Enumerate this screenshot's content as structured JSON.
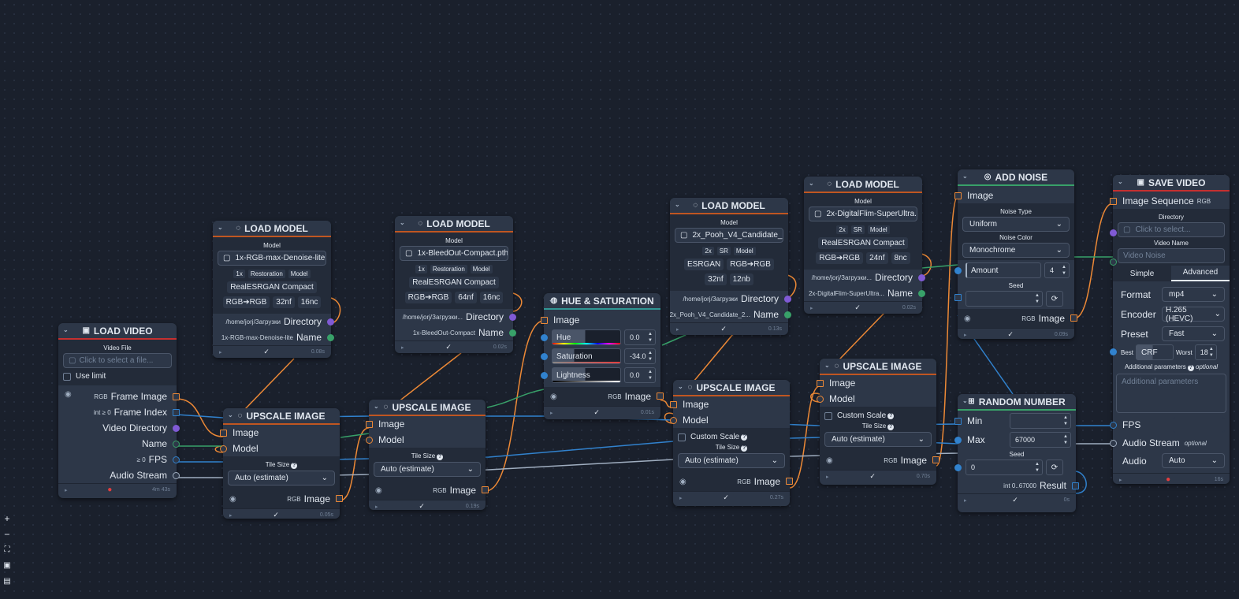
{
  "colors": {
    "bg": "#1a202c",
    "node": "#2d3748",
    "orange": "#ed8936",
    "blue": "#3182ce",
    "green": "#38a169",
    "purple": "#805ad5",
    "teal": "#319795"
  },
  "load_video": {
    "title": "LOAD VIDEO",
    "file_label": "Video File",
    "file_placeholder": "Click to select a file...",
    "use_limit": "Use limit",
    "frame_image_type": "RGB",
    "frame_image": "Frame Image",
    "frame_index_type": "int ≥ 0",
    "frame_index": "Frame Index",
    "video_directory": "Video Directory",
    "name": "Name",
    "fps_type": "≥ 0",
    "fps": "FPS",
    "audio_stream": "Audio Stream",
    "time": "4m 43s"
  },
  "load_model_1": {
    "title": "LOAD MODEL",
    "model_label": "Model",
    "file": "1x-RGB-max-Denoise-lite....",
    "scale": "1x",
    "task": "Restoration",
    "kind": "Model",
    "arch": "RealESRGAN Compact",
    "colors": "RGB➔RGB",
    "nf": "32nf",
    "nc": "16nc",
    "directory_value": "/home/jorj/Загрузки",
    "directory": "Directory",
    "name_value": "1x-RGB-max-Denoise-lite",
    "name": "Name",
    "time": "0.08s"
  },
  "load_model_2": {
    "title": "LOAD MODEL",
    "model_label": "Model",
    "file": "1x-BleedOut-Compact.pth",
    "scale": "1x",
    "task": "Restoration",
    "kind": "Model",
    "arch": "RealESRGAN Compact",
    "colors": "RGB➔RGB",
    "nf": "64nf",
    "nc": "16nc",
    "directory_value": "/home/jorj/Загрузки...",
    "directory": "Directory",
    "name_value": "1x-BleedOut-Compact",
    "name": "Name",
    "time": "0.02s"
  },
  "load_model_3": {
    "title": "LOAD MODEL",
    "model_label": "Model",
    "file": "2x_Pooh_V4_Candidate_2...",
    "scale": "2x",
    "task": "SR",
    "kind": "Model",
    "arch": "ESRGAN",
    "colors": "RGB➔RGB",
    "nf": "32nf",
    "nb": "12nb",
    "directory_value": "/home/jorj/Загрузки",
    "directory": "Directory",
    "name_value": "2x_Pooh_V4_Candidate_2...",
    "name": "Name",
    "time": "0.13s"
  },
  "load_model_4": {
    "title": "LOAD MODEL",
    "model_label": "Model",
    "file": "2x-DigitalFlim-SuperUltra...",
    "scale": "2x",
    "task": "SR",
    "kind": "Model",
    "arch": "RealESRGAN Compact",
    "colors": "RGB➔RGB",
    "nf": "24nf",
    "nc": "8nc",
    "directory_value": "/home/jorj/Загрузки...",
    "directory": "Directory",
    "name_value": "2x-DigitalFlim-SuperUltra...",
    "name": "Name",
    "time": "0.02s"
  },
  "upscale_1": {
    "title": "UPSCALE IMAGE",
    "image": "Image",
    "model": "Model",
    "tile_size": "Tile Size",
    "tile_value": "Auto (estimate)",
    "out_type": "RGB",
    "out": "Image",
    "time": "0.05s"
  },
  "upscale_2": {
    "title": "UPSCALE IMAGE",
    "image": "Image",
    "model": "Model",
    "tile_size": "Tile Size",
    "tile_value": "Auto (estimate)",
    "out_type": "RGB",
    "out": "Image",
    "time": "0.19s"
  },
  "upscale_3": {
    "title": "UPSCALE IMAGE",
    "image": "Image",
    "model": "Model",
    "custom_scale": "Custom Scale",
    "tile_size": "Tile Size",
    "tile_value": "Auto (estimate)",
    "out_type": "RGB",
    "out": "Image",
    "time": "0.27s"
  },
  "upscale_4": {
    "title": "UPSCALE IMAGE",
    "image": "Image",
    "model": "Model",
    "custom_scale": "Custom Scale",
    "tile_size": "Tile Size",
    "tile_value": "Auto (estimate)",
    "out_type": "RGB",
    "out": "Image",
    "time": "0.70s"
  },
  "hue": {
    "title": "HUE & SATURATION",
    "image": "Image",
    "hue": "Hue",
    "hue_value": "0.0",
    "sat": "Saturation",
    "sat_value": "-34.0",
    "light": "Lightness",
    "light_value": "0.0",
    "out_type": "RGB",
    "out": "Image",
    "time": "0.01s"
  },
  "noise": {
    "title": "ADD NOISE",
    "image": "Image",
    "type_label": "Noise Type",
    "type_value": "Uniform",
    "color_label": "Noise Color",
    "color_value": "Monochrome",
    "amount": "Amount",
    "amount_value": "4",
    "seed_label": "Seed",
    "out_type": "RGB",
    "out": "Image",
    "time": "0.09s"
  },
  "random": {
    "title": "RANDOM NUMBER",
    "min": "Min",
    "max": "Max",
    "max_value": "67000",
    "seed_label": "Seed",
    "seed_value": "0",
    "result_type": "int 0..67000",
    "result": "Result",
    "time": "0s"
  },
  "save": {
    "title": "SAVE VIDEO",
    "seq": "Image Sequence",
    "seq_type": "RGB",
    "dir_label": "Directory",
    "dir_placeholder": "Click to select...",
    "name_label": "Video Name",
    "name_placeholder": "Video Noise",
    "tab_simple": "Simple",
    "tab_advanced": "Advanced",
    "format": "Format",
    "format_value": "mp4",
    "encoder": "Encoder",
    "encoder_value": "H.265 (HEVC)",
    "preset": "Preset",
    "preset_value": "Fast",
    "best": "Best",
    "crf": "CRF",
    "worst": "Worst",
    "crf_value": "18",
    "addl": "Additional parameters",
    "optional": "optional",
    "addl_placeholder": "Additional parameters",
    "fps": "FPS",
    "audio_stream": "Audio Stream",
    "audio": "Audio",
    "audio_value": "Auto",
    "time": "16s"
  }
}
